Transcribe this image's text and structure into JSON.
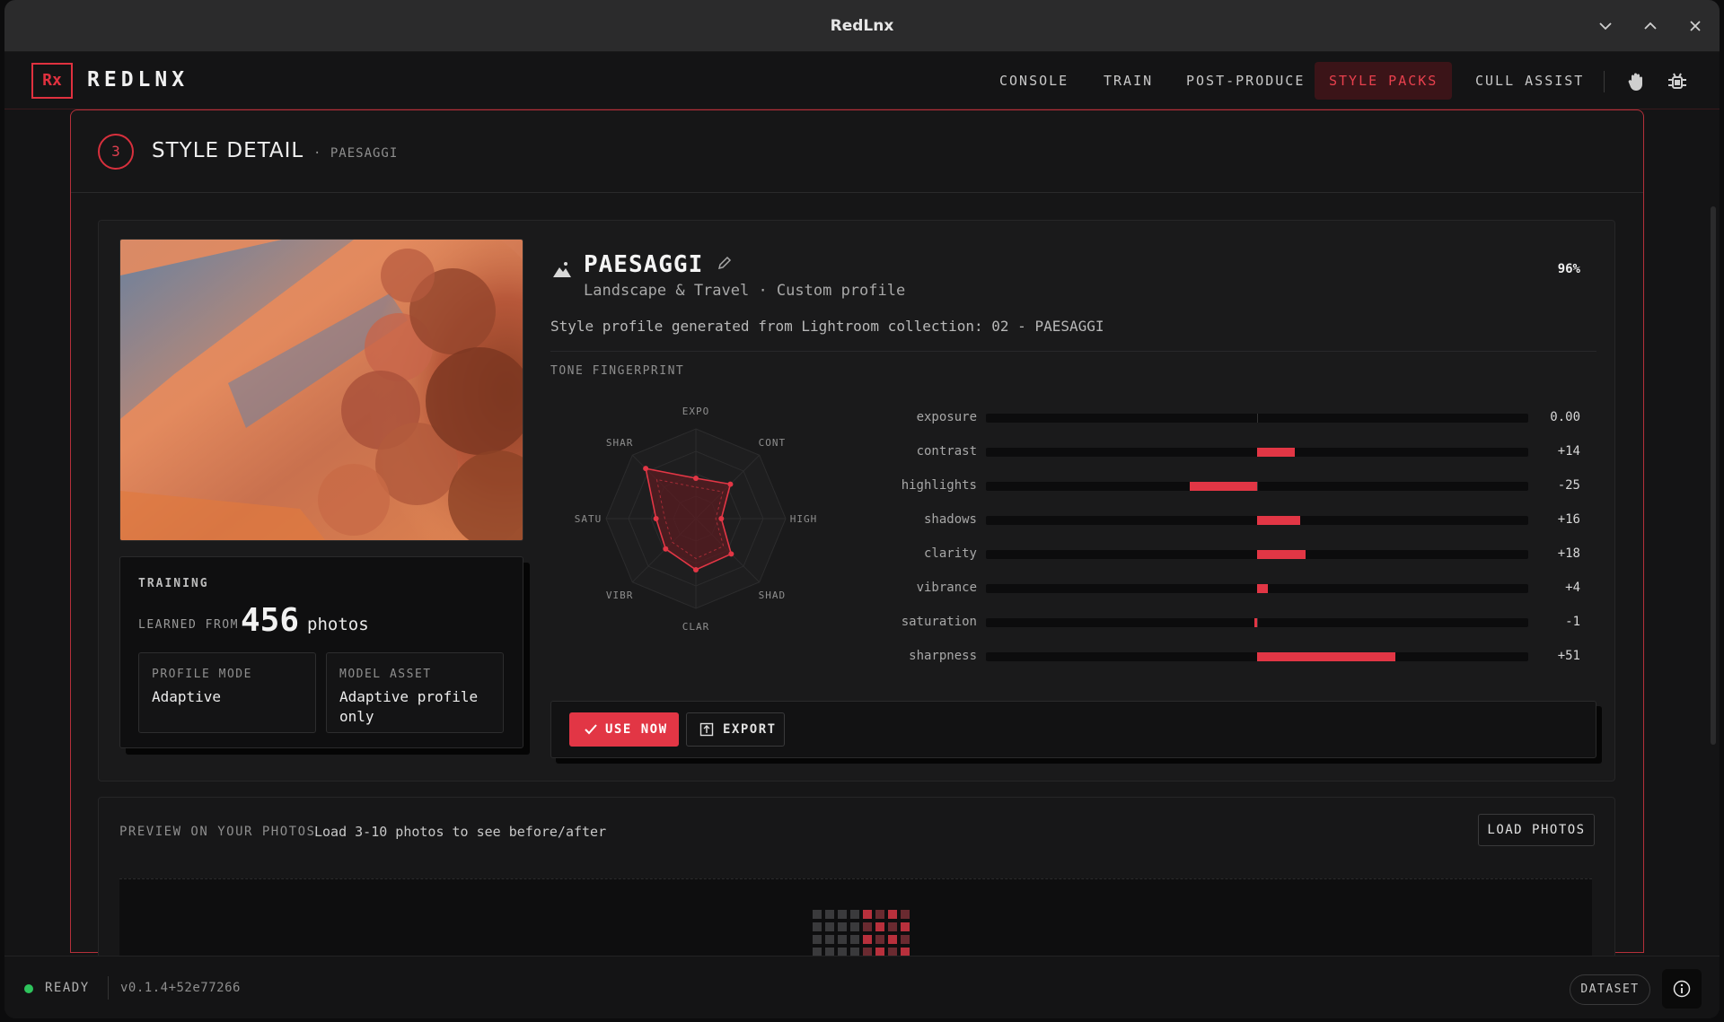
{
  "window": {
    "title": "RedLnx"
  },
  "nav": {
    "logo": "Rx",
    "brand": "REDLNX",
    "items": [
      {
        "label": "CONSOLE",
        "active": false
      },
      {
        "label": "TRAIN",
        "active": false
      },
      {
        "label": "POST-PRODUCE",
        "active": false
      },
      {
        "label": "STYLE PACKS",
        "active": true
      },
      {
        "label": "CULL ASSIST",
        "active": false
      }
    ],
    "icons": [
      "hand-icon",
      "bug-icon"
    ]
  },
  "panel": {
    "step": "3",
    "title": "STYLE DETAIL",
    "subtitle": "· PAESAGGI"
  },
  "profile": {
    "name": "PAESAGGI",
    "category": "Landscape & Travel · Custom profile",
    "match": "96%",
    "description": "Style profile generated from Lightroom collection: 02 - PAESAGGI",
    "tone_label": "TONE FINGERPRINT"
  },
  "training": {
    "label": "TRAINING",
    "learned_prefix": "LEARNED FROM",
    "count": "456",
    "unit": "photos",
    "profile_mode_label": "PROFILE MODE",
    "profile_mode_value": "Adaptive",
    "model_asset_label": "MODEL ASSET",
    "model_asset_value": "Adaptive profile only"
  },
  "radar": {
    "axes": [
      "EXPO",
      "CONT",
      "HIGH",
      "SHAD",
      "CLAR",
      "VIBR",
      "SATU",
      "SHAR"
    ]
  },
  "sliders": [
    {
      "name": "exposure",
      "value": 0,
      "display": "0.00"
    },
    {
      "name": "contrast",
      "value": 14,
      "display": "+14"
    },
    {
      "name": "highlights",
      "value": -25,
      "display": "-25"
    },
    {
      "name": "shadows",
      "value": 16,
      "display": "+16"
    },
    {
      "name": "clarity",
      "value": 18,
      "display": "+18"
    },
    {
      "name": "vibrance",
      "value": 4,
      "display": "+4"
    },
    {
      "name": "saturation",
      "value": -1,
      "display": "-1"
    },
    {
      "name": "sharpness",
      "value": 51,
      "display": "+51"
    }
  ],
  "actions": {
    "use_now": "USE NOW",
    "export": "EXPORT"
  },
  "preview": {
    "label": "PREVIEW ON YOUR PHOTOS",
    "hint": "Load 3-10 photos to see before/after",
    "load_button": "LOAD PHOTOS"
  },
  "status": {
    "state": "READY",
    "version": "v0.1.4+52e77266",
    "dataset_button": "DATASET"
  },
  "colors": {
    "accent": "#e23645",
    "ready": "#2ec45c"
  }
}
